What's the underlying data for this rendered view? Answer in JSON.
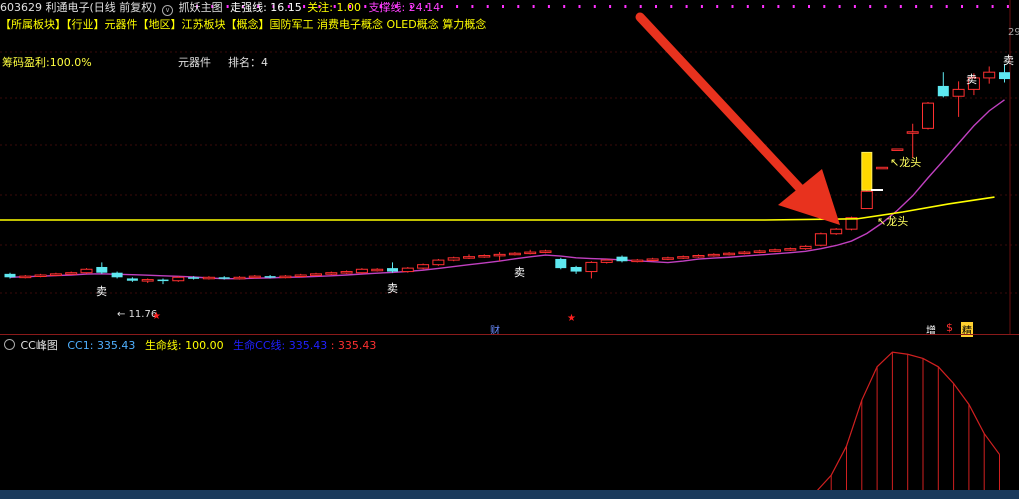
{
  "header": {
    "stock": "603629 利通电子(日线 前复权)",
    "indicator_name": "抓妖主图",
    "zhuqiang_label": "走强线: 16.15",
    "guanzhu_label": "关注: 1.00",
    "zhicheng_label": "支撑线: 24.14"
  },
  "sectors": {
    "text": "【所属板块】【行业】元器件【地区】江苏板块【概念】国防军工 消费电子概念 OLED概念 算力概念"
  },
  "info": {
    "chouma": "筹码盈利:100.0%",
    "industry": "元器件",
    "rank": "排名：4"
  },
  "annotations": {
    "sell": "卖",
    "low_price": "11.76",
    "cai": "财",
    "zeng": "增",
    "jing": "精",
    "longtou_1": "龙头",
    "longtou_2": "龙头",
    "right_edge": "29"
  },
  "sub": {
    "name": "CC峰图",
    "cc1": "CC1: 335.43",
    "shengming": "生命线: 100.00",
    "shengming_cc": "生命CC线: 335.43",
    "extra": ": 335.43"
  },
  "colors": {
    "yellow_line": "#ffff00",
    "purple_ma": "#c040c0",
    "up_candle": "#ff3030",
    "down_candle": "#5ee8f0",
    "arrow": "#e8321e",
    "sub_red": "#d02020"
  },
  "chart_data": {
    "type": "candlestick",
    "price_label_low": 11.76,
    "candles": [
      [
        15.9,
        15.6,
        16.0,
        15.5
      ],
      [
        15.6,
        15.7,
        15.8,
        15.5
      ],
      [
        15.7,
        15.8,
        15.9,
        15.6
      ],
      [
        15.8,
        15.9,
        16.0,
        15.7
      ],
      [
        15.9,
        16.0,
        16.1,
        15.8
      ],
      [
        16.0,
        16.3,
        16.4,
        15.9
      ],
      [
        16.5,
        16.0,
        16.9,
        15.9
      ],
      [
        16.0,
        15.6,
        16.1,
        15.5
      ],
      [
        15.5,
        15.3,
        15.6,
        15.2
      ],
      [
        15.3,
        15.4,
        15.5,
        15.1
      ],
      [
        15.4,
        15.3,
        15.5,
        15.0
      ],
      [
        15.3,
        15.6,
        15.7,
        15.2
      ],
      [
        15.6,
        15.5,
        15.7,
        15.4
      ],
      [
        15.5,
        15.6,
        15.7,
        15.4
      ],
      [
        15.6,
        15.5,
        15.7,
        15.4
      ],
      [
        15.5,
        15.6,
        15.7,
        15.4
      ],
      [
        15.6,
        15.7,
        15.8,
        15.5
      ],
      [
        15.7,
        15.6,
        15.8,
        15.5
      ],
      [
        15.6,
        15.7,
        15.8,
        15.5
      ],
      [
        15.7,
        15.8,
        15.9,
        15.6
      ],
      [
        15.8,
        15.9,
        16.0,
        15.7
      ],
      [
        15.9,
        16.0,
        16.1,
        15.8
      ],
      [
        16.0,
        16.1,
        16.2,
        15.9
      ],
      [
        16.0,
        16.3,
        16.4,
        15.9
      ],
      [
        16.2,
        16.3,
        16.4,
        16.1
      ],
      [
        16.4,
        16.1,
        16.9,
        16.0
      ],
      [
        16.1,
        16.4,
        16.5,
        16.0
      ],
      [
        16.4,
        16.7,
        16.8,
        16.3
      ],
      [
        16.7,
        17.1,
        17.2,
        16.6
      ],
      [
        17.1,
        17.3,
        17.4,
        17.0
      ],
      [
        17.3,
        17.4,
        17.6,
        17.2
      ],
      [
        17.4,
        17.5,
        17.6,
        17.3
      ],
      [
        17.5,
        17.6,
        17.8,
        17.0
      ],
      [
        17.6,
        17.7,
        17.8,
        17.5
      ],
      [
        17.7,
        17.8,
        18.0,
        17.6
      ],
      [
        17.8,
        17.9,
        18.0,
        17.7
      ],
      [
        17.2,
        16.4,
        17.3,
        16.3
      ],
      [
        16.5,
        16.1,
        16.6,
        15.9
      ],
      [
        16.1,
        16.9,
        17.0,
        15.5
      ],
      [
        16.9,
        17.1,
        17.2,
        16.8
      ],
      [
        17.4,
        17.0,
        17.5,
        16.9
      ],
      [
        17.0,
        17.1,
        17.2,
        16.9
      ],
      [
        17.1,
        17.2,
        17.3,
        17.0
      ],
      [
        17.2,
        17.3,
        17.4,
        17.1
      ],
      [
        17.3,
        17.4,
        17.5,
        17.2
      ],
      [
        17.4,
        17.5,
        17.6,
        17.3
      ],
      [
        17.5,
        17.6,
        17.7,
        17.4
      ],
      [
        17.6,
        17.7,
        17.8,
        17.5
      ],
      [
        17.7,
        17.8,
        17.9,
        17.6
      ],
      [
        17.8,
        17.9,
        18.0,
        17.7
      ],
      [
        17.9,
        18.0,
        18.1,
        17.8
      ],
      [
        18.0,
        18.1,
        18.2,
        17.9
      ],
      [
        18.1,
        18.3,
        18.4,
        18.0
      ],
      [
        18.4,
        19.4,
        19.5,
        18.3
      ],
      [
        19.4,
        19.8,
        19.9,
        19.3
      ],
      [
        19.8,
        20.8,
        20.9,
        19.7
      ],
      [
        21.6,
        23.1,
        23.2,
        21.6
      ],
      [
        25.2,
        25.2,
        25.2,
        25.2
      ],
      [
        26.8,
        26.8,
        26.8,
        26.8
      ],
      [
        28.3,
        28.3,
        29.0,
        26.0
      ],
      [
        28.6,
        30.8,
        30.9,
        28.5
      ],
      [
        32.3,
        31.4,
        33.5,
        31.3
      ],
      [
        31.4,
        32.0,
        32.7,
        29.6
      ],
      [
        32.0,
        33.0,
        33.4,
        31.5
      ],
      [
        33.0,
        33.5,
        34.0,
        32.5
      ],
      [
        33.5,
        32.9,
        34.2,
        32.6
      ]
    ],
    "yellow_line": [
      [
        0,
        20.6
      ],
      [
        20,
        20.6
      ],
      [
        35,
        20.6
      ],
      [
        50,
        20.6
      ],
      [
        56,
        20.7
      ],
      [
        59,
        21.3
      ],
      [
        62,
        22.0
      ],
      [
        65,
        22.6
      ]
    ],
    "cc_peak": {
      "max": 335.43
    }
  }
}
